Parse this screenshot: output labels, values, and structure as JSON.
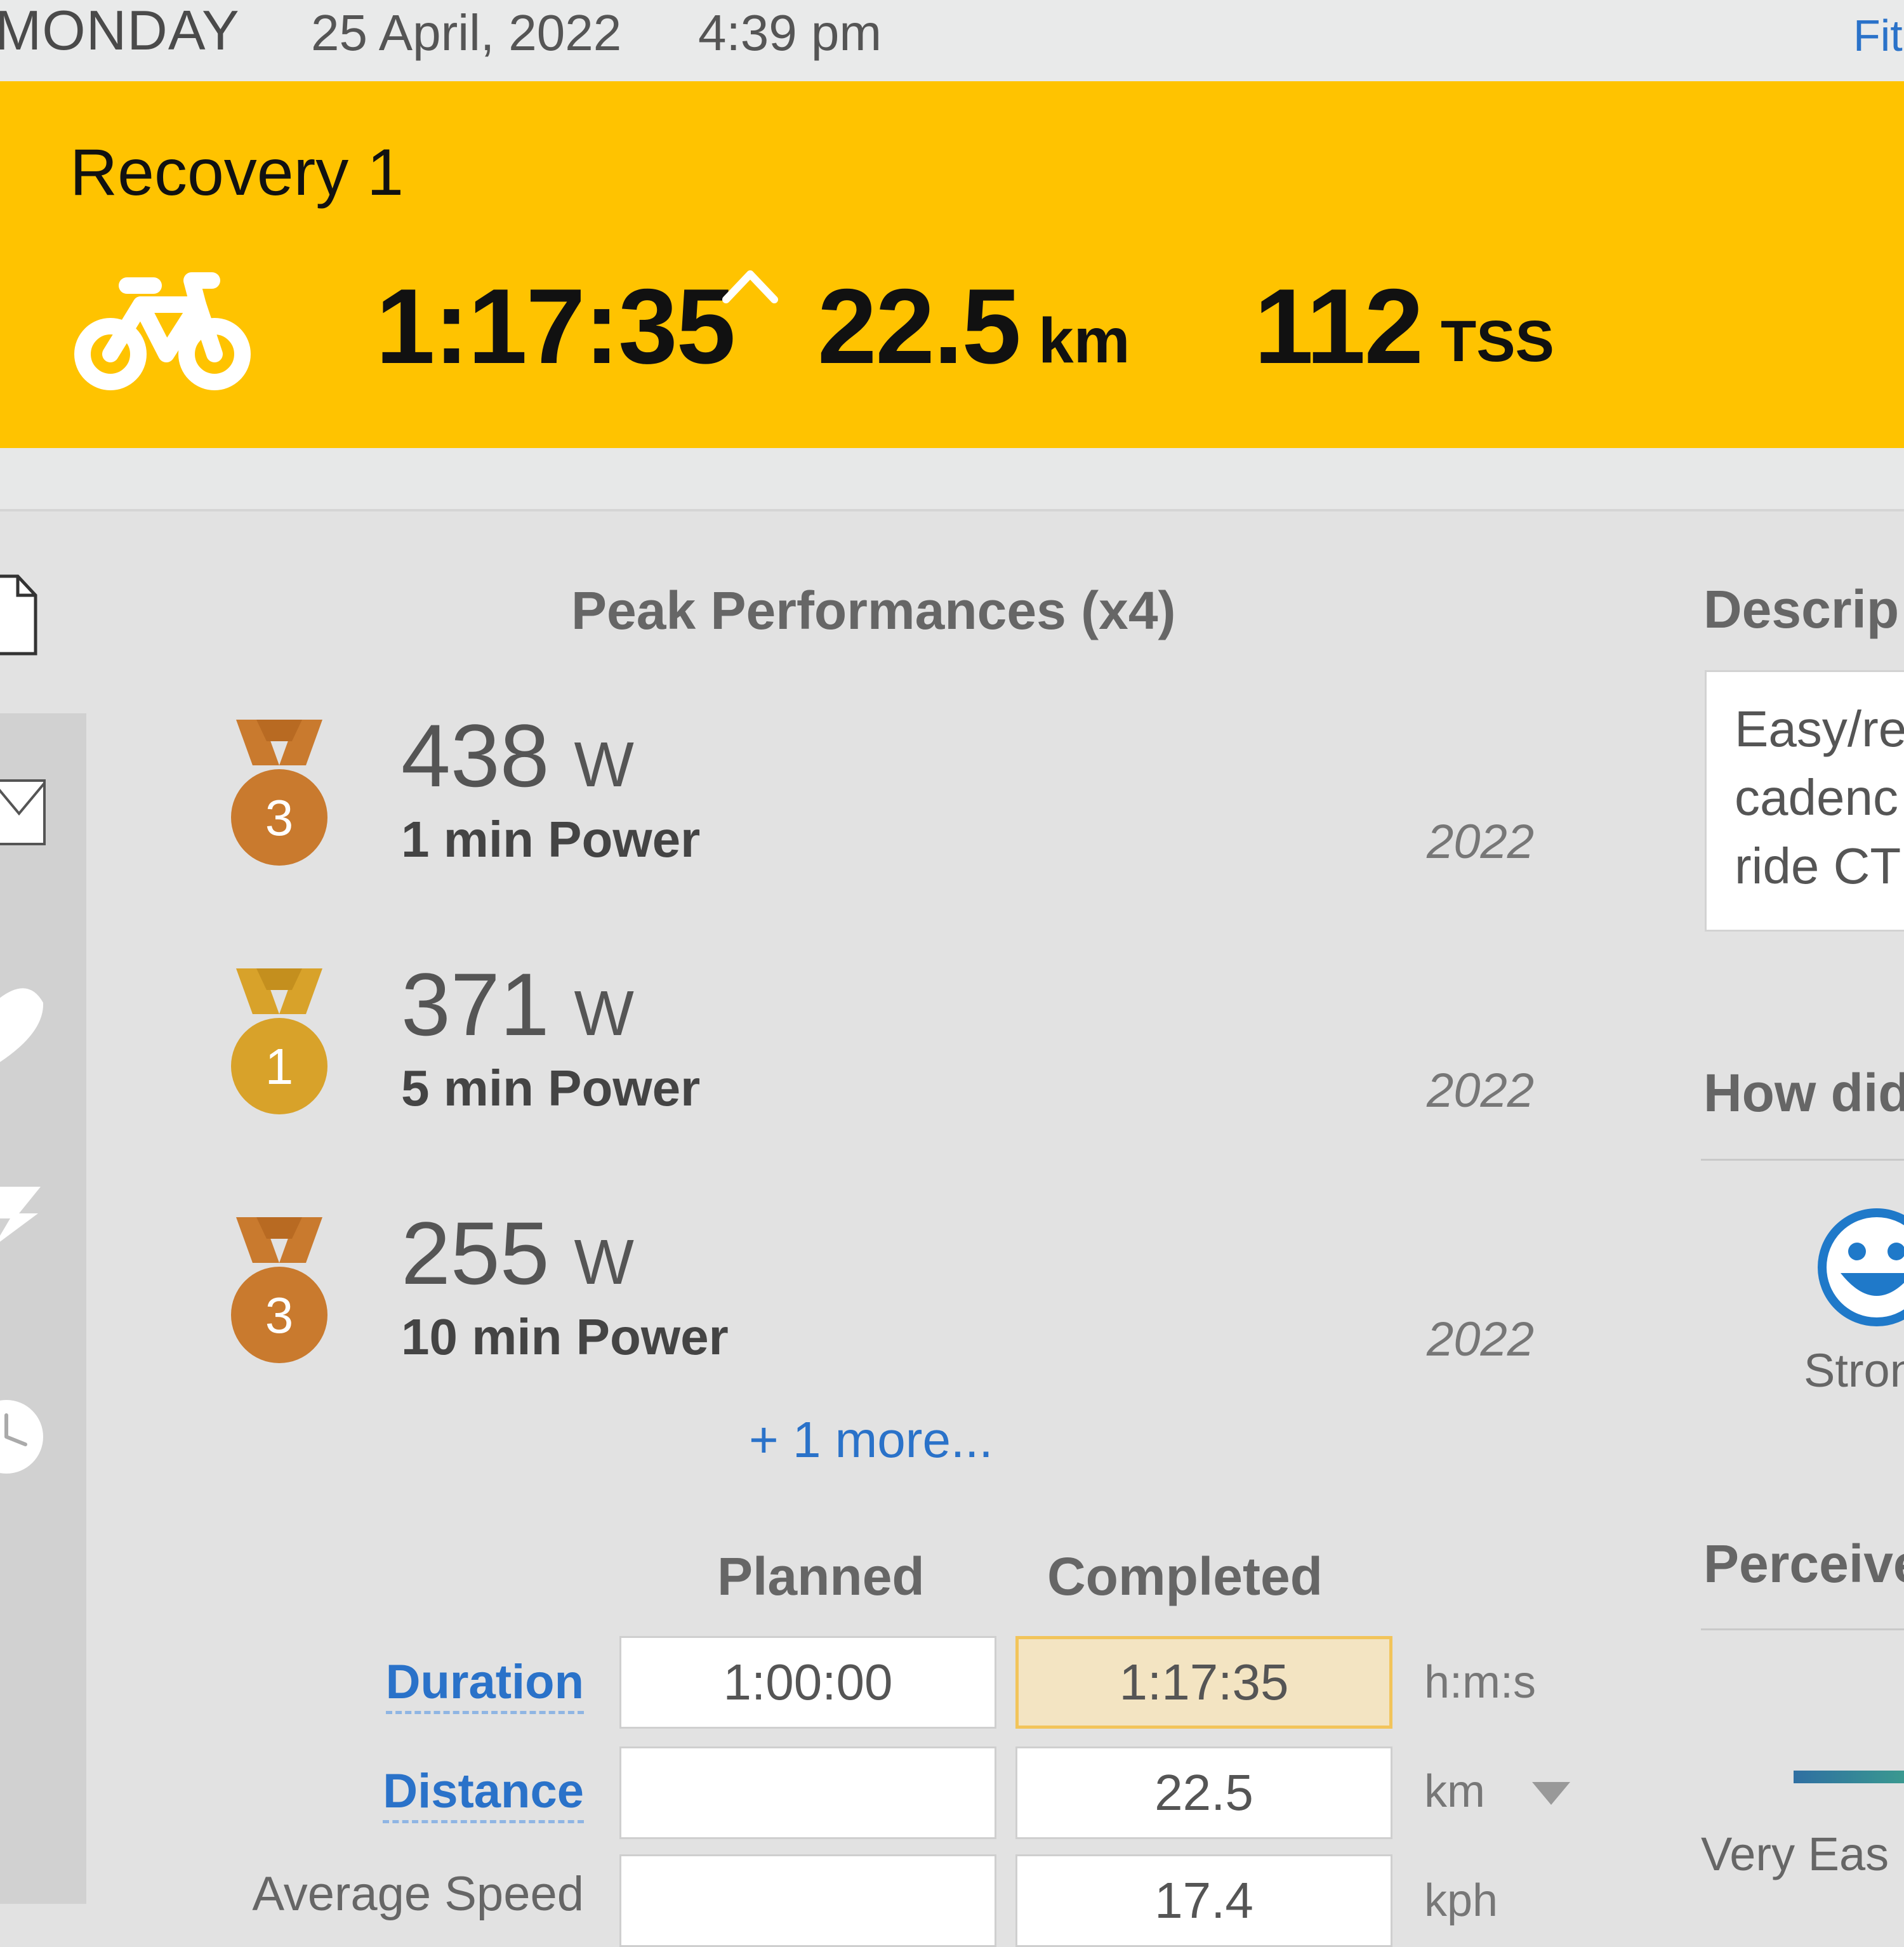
{
  "header": {
    "day": "MONDAY",
    "date": "25 April, 2022",
    "time": "4:39 pm",
    "right_link": "Fit"
  },
  "workout": {
    "title": "Recovery 1",
    "sport_icon": "bike-icon",
    "duration": "1:17:35",
    "distance_value": "22.5",
    "distance_unit": "km",
    "tss_value": "112",
    "tss_unit": "TSS"
  },
  "sidebar": {
    "icons": [
      "document-icon",
      "mail-icon",
      "comment-icon",
      "lightning-icon",
      "clock-icon"
    ]
  },
  "peak_performances": {
    "title": "Peak Performances (x4)",
    "items": [
      {
        "rank": "3",
        "value": "438",
        "unit": "W",
        "label": "1 min Power",
        "year": "2022",
        "medal_color": "#c97a2e"
      },
      {
        "rank": "1",
        "value": "371",
        "unit": "W",
        "label": "5 min Power",
        "year": "2022",
        "medal_color": "#d8a22a"
      },
      {
        "rank": "3",
        "value": "255",
        "unit": "W",
        "label": "10 min Power",
        "year": "2022",
        "medal_color": "#c97a2e"
      }
    ],
    "more_link": "+ 1 more..."
  },
  "summary_table": {
    "col_planned": "Planned",
    "col_completed": "Completed",
    "rows": [
      {
        "label": "Duration",
        "planned": "1:00:00",
        "completed": "1:17:35",
        "unit": "h:m:s"
      },
      {
        "label": "Distance",
        "planned": "",
        "completed": "22.5",
        "unit": "km"
      },
      {
        "label": "Average Speed",
        "planned": "",
        "completed": "17.4",
        "unit": "kph"
      }
    ]
  },
  "right_panel": {
    "description_header": "Descrip",
    "description_lines": [
      "Easy/re",
      "cadenc",
      "ride CT"
    ],
    "feel_header": "How did",
    "feel_label": "Stron",
    "rpe_header": "Perceive",
    "rpe_label": "Very Eas"
  },
  "colors": {
    "banner": "#ffc300",
    "link": "#2a72c9",
    "highlight_cell": "#f3e4c2"
  }
}
